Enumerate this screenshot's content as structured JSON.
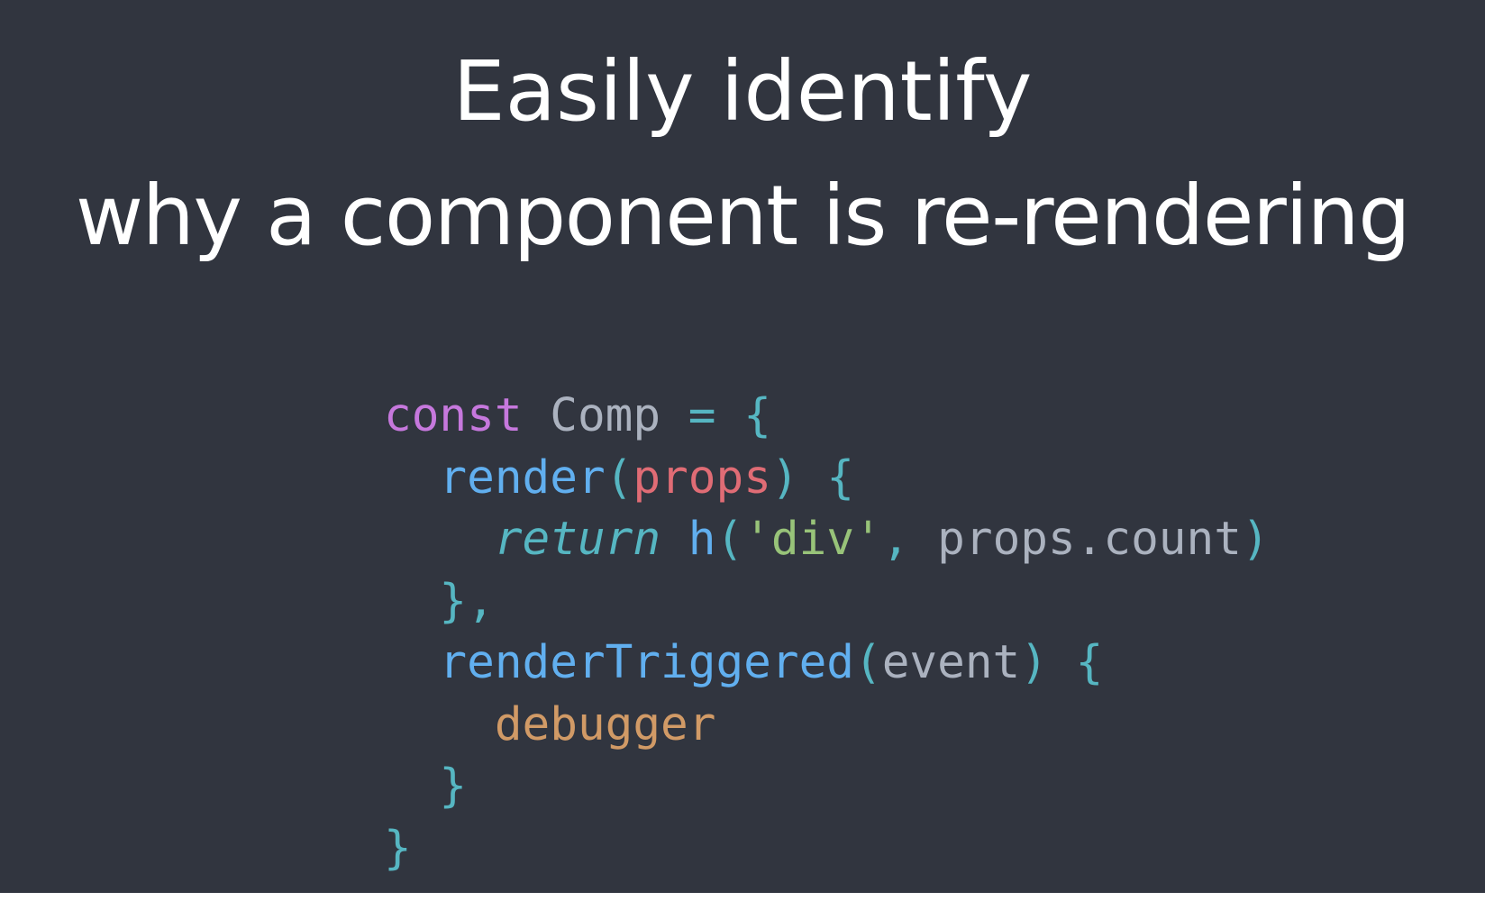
{
  "slide": {
    "title_line_1": "Easily identify",
    "title_line_2": "why a component is re-rendering",
    "background_color": "#31353f",
    "title_color": "#ffffff"
  },
  "code": {
    "language": "javascript",
    "lines": [
      [
        {
          "text": "const",
          "kind": "keyword"
        },
        {
          "text": " ",
          "kind": "plain"
        },
        {
          "text": "Comp",
          "kind": "ident"
        },
        {
          "text": " = ",
          "kind": "punct"
        },
        {
          "text": "{",
          "kind": "punct"
        }
      ],
      [
        {
          "text": "  ",
          "kind": "plain"
        },
        {
          "text": "render",
          "kind": "func"
        },
        {
          "text": "(",
          "kind": "punct"
        },
        {
          "text": "props",
          "kind": "param"
        },
        {
          "text": ") {",
          "kind": "punct"
        }
      ],
      [
        {
          "text": "    ",
          "kind": "plain"
        },
        {
          "text": "return",
          "kind": "return"
        },
        {
          "text": " ",
          "kind": "plain"
        },
        {
          "text": "h",
          "kind": "func"
        },
        {
          "text": "(",
          "kind": "punct"
        },
        {
          "text": "'div'",
          "kind": "string"
        },
        {
          "text": ", ",
          "kind": "punct"
        },
        {
          "text": "props.count",
          "kind": "property"
        },
        {
          "text": ")",
          "kind": "punct"
        }
      ],
      [
        {
          "text": "  ",
          "kind": "plain"
        },
        {
          "text": "},",
          "kind": "punct"
        }
      ],
      [
        {
          "text": "  ",
          "kind": "plain"
        },
        {
          "text": "renderTriggered",
          "kind": "func"
        },
        {
          "text": "(",
          "kind": "punct"
        },
        {
          "text": "event",
          "kind": "property"
        },
        {
          "text": ") {",
          "kind": "punct"
        }
      ],
      [
        {
          "text": "    ",
          "kind": "plain"
        },
        {
          "text": "debugger",
          "kind": "debugger"
        }
      ],
      [
        {
          "text": "  ",
          "kind": "plain"
        },
        {
          "text": "}",
          "kind": "punct"
        }
      ],
      [
        {
          "text": "}",
          "kind": "punct"
        }
      ]
    ],
    "colors": {
      "keyword": "#c678dd",
      "ident": "#abb2bf",
      "punct": "#56b6c2",
      "func": "#61afef",
      "param": "#e06c75",
      "return": "#56b6c2",
      "string": "#98c379",
      "property": "#abb2bf",
      "debugger": "#d19a66",
      "plain": "#abb2bf"
    }
  }
}
